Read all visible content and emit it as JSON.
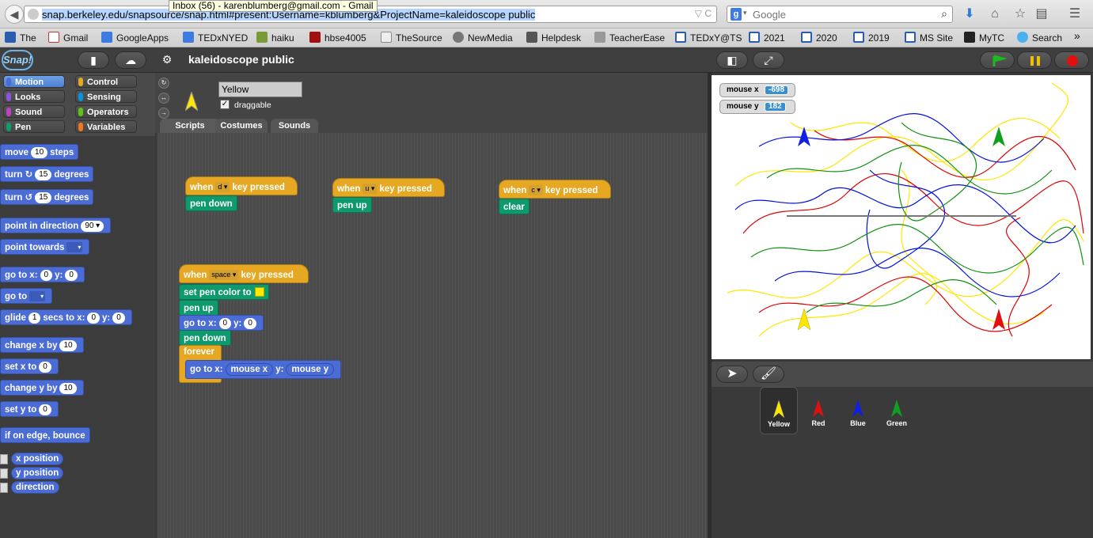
{
  "browser": {
    "url": "snap.berkeley.edu/snapsource/snap.html#present:Username=kblumberg&ProjectName=kaleidoscope public",
    "tooltip": "Inbox (56) - karenblumberg@gmail.com - Gmail",
    "search_placeholder": "Google",
    "search_engine_letter": "g"
  },
  "bookmarks": [
    {
      "label": "The",
      "icon": "the-bookmark-icon"
    },
    {
      "label": "Gmail",
      "icon": "gmail-icon"
    },
    {
      "label": "GoogleApps",
      "icon": "googleapps-icon"
    },
    {
      "label": "TEDxNYED",
      "icon": "tedxnyed-icon"
    },
    {
      "label": "haiku",
      "icon": "haiku-icon"
    },
    {
      "label": "hbse4005",
      "icon": "hbse4005-icon"
    },
    {
      "label": "TheSource",
      "icon": "thesource-icon"
    },
    {
      "label": "NewMedia",
      "icon": "newmedia-icon"
    },
    {
      "label": "Helpdesk",
      "icon": "helpdesk-icon"
    },
    {
      "label": "TeacherEase",
      "icon": "teacherease-icon"
    },
    {
      "label": "TEDxY@TS",
      "icon": "tedxyts-icon"
    },
    {
      "label": "2021",
      "icon": "folder-icon"
    },
    {
      "label": "2020",
      "icon": "folder-icon"
    },
    {
      "label": "2019",
      "icon": "folder-icon"
    },
    {
      "label": "MS Site",
      "icon": "folder-icon"
    },
    {
      "label": "MyTC",
      "icon": "mytc-icon"
    },
    {
      "label": "Search",
      "icon": "twitter-icon"
    }
  ],
  "bookmarks_overflow": "»",
  "ide": {
    "logo": "Snap!",
    "project_title": "kaleidoscope public"
  },
  "categories": [
    {
      "label": "Motion",
      "color": "#4a6cd4"
    },
    {
      "label": "Control",
      "color": "#e6a822"
    },
    {
      "label": "Looks",
      "color": "#8a55d7"
    },
    {
      "label": "Sensing",
      "color": "#0494dc"
    },
    {
      "label": "Sound",
      "color": "#bb42c3"
    },
    {
      "label": "Operators",
      "color": "#62c213"
    },
    {
      "label": "Pen",
      "color": "#0e9a6c"
    },
    {
      "label": "Variables",
      "color": "#f3761d"
    }
  ],
  "palette": {
    "move": {
      "pre": "move",
      "val": "10",
      "post": "steps"
    },
    "turn_cw": {
      "pre": "turn",
      "val": "15",
      "post": "degrees"
    },
    "turn_ccw": {
      "pre": "turn",
      "val": "15",
      "post": "degrees"
    },
    "point_dir": {
      "pre": "point in direction",
      "val": "90"
    },
    "point_towards": {
      "pre": "point towards"
    },
    "goto_xy": {
      "pre": "go to x:",
      "x": "0",
      "mid": "y:",
      "y": "0"
    },
    "goto": {
      "pre": "go to"
    },
    "glide": {
      "pre": "glide",
      "val": "1",
      "mid": "secs to x:",
      "x": "0",
      "mid2": "y:",
      "y": "0"
    },
    "change_x": {
      "pre": "change x by",
      "val": "10"
    },
    "set_x": {
      "pre": "set x to",
      "val": "0"
    },
    "change_y": {
      "pre": "change y by",
      "val": "10"
    },
    "set_y": {
      "pre": "set y to",
      "val": "0"
    },
    "bounce": "if on edge, bounce",
    "x_position": "x position",
    "y_position": "y position",
    "direction": "direction"
  },
  "sprite": {
    "name": "Yellow",
    "draggable_label": "draggable",
    "draggable_checked": "✓"
  },
  "tabs": [
    "Scripts",
    "Costumes",
    "Sounds"
  ],
  "scripts": {
    "d_hat": {
      "when": "when",
      "key": "d",
      "post": "key pressed"
    },
    "pen_down": "pen down",
    "u_hat": {
      "when": "when",
      "key": "u",
      "post": "key pressed"
    },
    "pen_up": "pen up",
    "c_hat": {
      "when": "when",
      "key": "c",
      "post": "key pressed"
    },
    "clear": "clear",
    "space_hat": {
      "when": "when",
      "key": "space",
      "post": "key pressed"
    },
    "set_pen_color": "set pen color to",
    "pen_color": "#ffe600",
    "pen_up2": "pen up",
    "goto_xy": {
      "pre": "go to x:",
      "x": "0",
      "mid": "y:",
      "y": "0"
    },
    "pen_down2": "pen down",
    "forever": "forever",
    "goto_mouse": {
      "pre": "go to x:",
      "x": "mouse x",
      "mid": "y:",
      "y": "mouse y"
    }
  },
  "stage": {
    "watchers": [
      {
        "label": "mouse x",
        "value": "-698"
      },
      {
        "label": "mouse y",
        "value": "182"
      }
    ],
    "line_colors": [
      "#ffe600",
      "#e00000",
      "#0010e0",
      "#109010"
    ]
  },
  "corral": {
    "sprites": [
      {
        "name": "Yellow",
        "color": "#ffe600"
      },
      {
        "name": "Red",
        "color": "#e01010"
      },
      {
        "name": "Blue",
        "color": "#1020e0"
      },
      {
        "name": "Green",
        "color": "#10a020"
      }
    ]
  }
}
